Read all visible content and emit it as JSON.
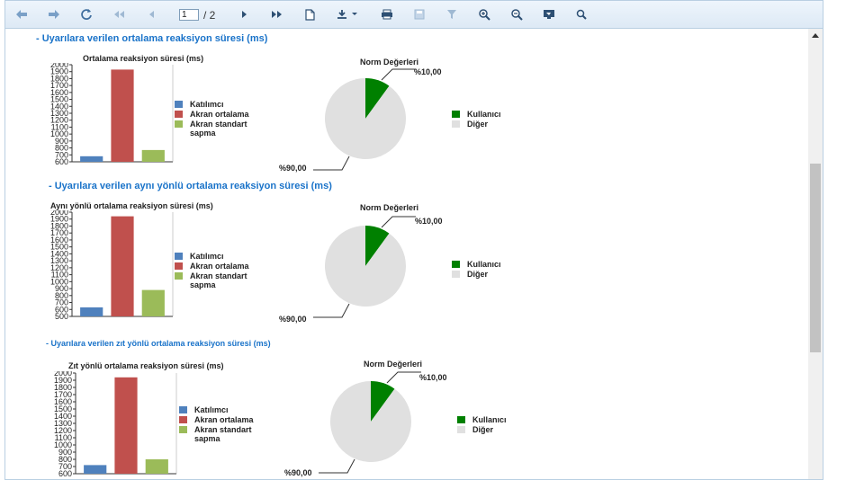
{
  "toolbar": {
    "page_current": "1",
    "page_total": "/ 2",
    "icons": [
      "back-icon",
      "forward-icon",
      "refresh-icon",
      "first-page-icon",
      "prev-page-icon",
      "next-page-icon",
      "last-page-icon",
      "new-document-icon",
      "download-icon",
      "print-icon",
      "save-icon",
      "filter-icon",
      "zoom-in-icon",
      "zoom-out-icon",
      "screen-icon",
      "search-icon"
    ]
  },
  "colors": {
    "participant": "#4f81bd",
    "peer_avg": "#c0504d",
    "peer_std": "#9bbb59",
    "user": "#008000",
    "other": "#e0e0e0",
    "title": "#1a73c9"
  },
  "sections": [
    {
      "title": "- Uyarılara verilen ortalama reaksiyon süresi (ms)",
      "bar_title": "Ortalama reaksiyon süresi (ms)",
      "pie_title": "Norm Değerleri",
      "pie_label_small": "%10,00",
      "pie_label_large": "%90,00",
      "legend": [
        "Katılımcı",
        "Akran ortalama",
        "Akran standart sapma"
      ],
      "pie_legend": [
        "Kullanıcı",
        "Diğer"
      ]
    },
    {
      "title": "- Uyarılara verilen aynı yönlü ortalama reaksiyon süresi (ms)",
      "bar_title": "Aynı yönlü ortalama reaksiyon süresi (ms)",
      "pie_title": "Norm Değerleri",
      "pie_label_small": "%10,00",
      "pie_label_large": "%90,00",
      "legend": [
        "Katılımcı",
        "Akran ortalama",
        "Akran standart sapma"
      ],
      "pie_legend": [
        "Kullanıcı",
        "Diğer"
      ]
    },
    {
      "title": "- Uyarılara verilen zıt yönlü ortalama reaksiyon süresi (ms)",
      "bar_title": "Zıt yönlü ortalama reaksiyon süresi (ms)",
      "pie_title": "Norm Değerleri",
      "pie_label_small": "%10,00",
      "pie_label_large": "%90,00",
      "legend": [
        "Katılımcı",
        "Akran ortalama",
        "Akran standart sapma"
      ],
      "pie_legend": [
        "Kullanıcı",
        "Diğer"
      ]
    }
  ],
  "chart_data": [
    {
      "type": "bar",
      "title": "Ortalama reaksiyon süresi (ms)",
      "categories": [
        "Katılımcı",
        "Akran ortalama",
        "Akran standart sapma"
      ],
      "values": [
        680,
        1930,
        770
      ],
      "ylim": [
        600,
        2000
      ],
      "yticks": [
        600,
        700,
        800,
        900,
        1000,
        1100,
        1200,
        1300,
        1400,
        1500,
        1600,
        1700,
        1800,
        1900,
        2000
      ],
      "legend": "right",
      "grid": false
    },
    {
      "type": "pie",
      "title": "Norm Değerleri",
      "categories": [
        "Kullanıcı",
        "Diğer"
      ],
      "values": [
        10,
        90
      ],
      "labels": [
        "%10,00",
        "%90,00"
      ],
      "legend": "right"
    },
    {
      "type": "bar",
      "title": "Aynı yönlü ortalama reaksiyon süresi (ms)",
      "categories": [
        "Katılımcı",
        "Akran ortalama",
        "Akran standart sapma"
      ],
      "values": [
        630,
        1940,
        880
      ],
      "ylim": [
        500,
        2000
      ],
      "yticks": [
        500,
        600,
        700,
        800,
        900,
        1000,
        1100,
        1200,
        1300,
        1400,
        1500,
        1600,
        1700,
        1800,
        1900,
        2000
      ],
      "legend": "right",
      "grid": false
    },
    {
      "type": "pie",
      "title": "Norm Değerleri",
      "categories": [
        "Kullanıcı",
        "Diğer"
      ],
      "values": [
        10,
        90
      ],
      "labels": [
        "%10,00",
        "%90,00"
      ],
      "legend": "right"
    },
    {
      "type": "bar",
      "title": "Zıt yönlü ortalama reaksiyon süresi (ms)",
      "categories": [
        "Katılımcı",
        "Akran ortalama",
        "Akran standart sapma"
      ],
      "values": [
        720,
        1940,
        800
      ],
      "ylim": [
        600,
        2000
      ],
      "yticks": [
        600,
        700,
        800,
        900,
        1000,
        1100,
        1200,
        1300,
        1400,
        1500,
        1600,
        1700,
        1800,
        1900,
        2000
      ],
      "legend": "right",
      "grid": false
    },
    {
      "type": "pie",
      "title": "Norm Değerleri",
      "categories": [
        "Kullanıcı",
        "Diğer"
      ],
      "values": [
        10,
        90
      ],
      "labels": [
        "%10,00",
        "%90,00"
      ],
      "legend": "right"
    }
  ]
}
